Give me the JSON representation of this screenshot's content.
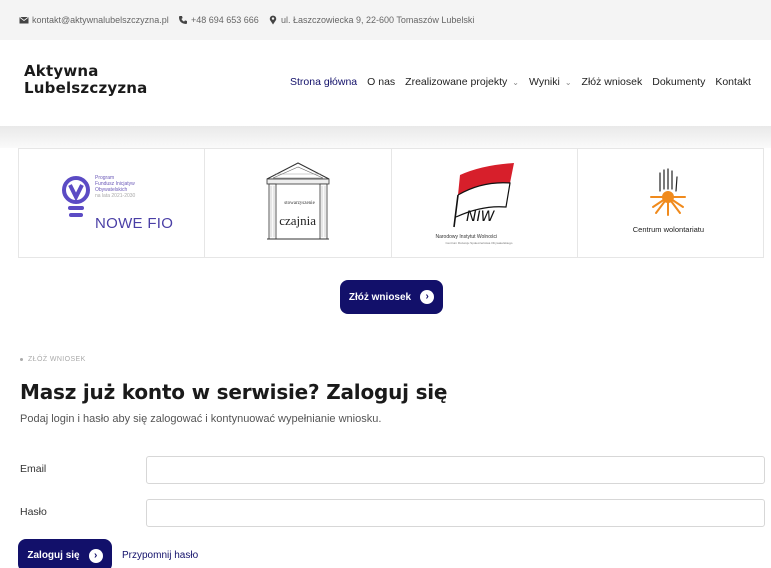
{
  "topbar": {
    "email": "kontakt@aktywnalubelszczyzna.pl",
    "phone": "+48 694 653 666",
    "address": "ul. Łaszczowiecka 9, 22-600 Tomaszów Lubelski",
    "icons": [
      "envelope-icon",
      "phone-icon",
      "map-pin-icon"
    ]
  },
  "logo": {
    "line1": "Aktywna",
    "line2": "Lubelszczyzna"
  },
  "nav": {
    "items": [
      {
        "label": "Strona główna",
        "active": true
      },
      {
        "label": "O nas"
      },
      {
        "label": "Zrealizowane projekty",
        "dropdown": true
      },
      {
        "label": "Wyniki",
        "dropdown": true
      },
      {
        "label": "Złóż wniosek"
      },
      {
        "label": "Dokumenty"
      },
      {
        "label": "Kontakt"
      }
    ]
  },
  "partners": {
    "fio": {
      "small_line1": "Program",
      "small_line2": "Fundusz Inicjatyw",
      "small_line3": "Obywatelskich",
      "small_line4": "na lata 2021-2030",
      "big": "NOWE FIO"
    },
    "czajnia": {
      "small": "stowarzyszenie",
      "big": "czajnia"
    },
    "niw": {
      "flag_text": "NIW",
      "name": "Narodowy Instytut Wolności",
      "sub": "Centrum Rozwoju Społeczeństwa Obywatelskiego"
    },
    "cw": {
      "name": "Centrum wolontariatu"
    }
  },
  "cta": {
    "label": "Złóż wniosek",
    "icon": "chevron-right-icon"
  },
  "breadcrumb": "ZŁÓŻ WNIOSEK",
  "login": {
    "title": "Masz już konto w serwisie? Zaloguj się",
    "lead": "Podaj login i hasło aby się zalogować i kontynuować wypełnianie wniosku.",
    "email_label": "Email",
    "email_value": "",
    "password_label": "Hasło",
    "password_value": "",
    "submit_label": "Zaloguj się",
    "remind_label": "Przypomnij hasło"
  },
  "colors": {
    "brand": "#12106a",
    "topbar_bg": "#f4f4f4"
  }
}
